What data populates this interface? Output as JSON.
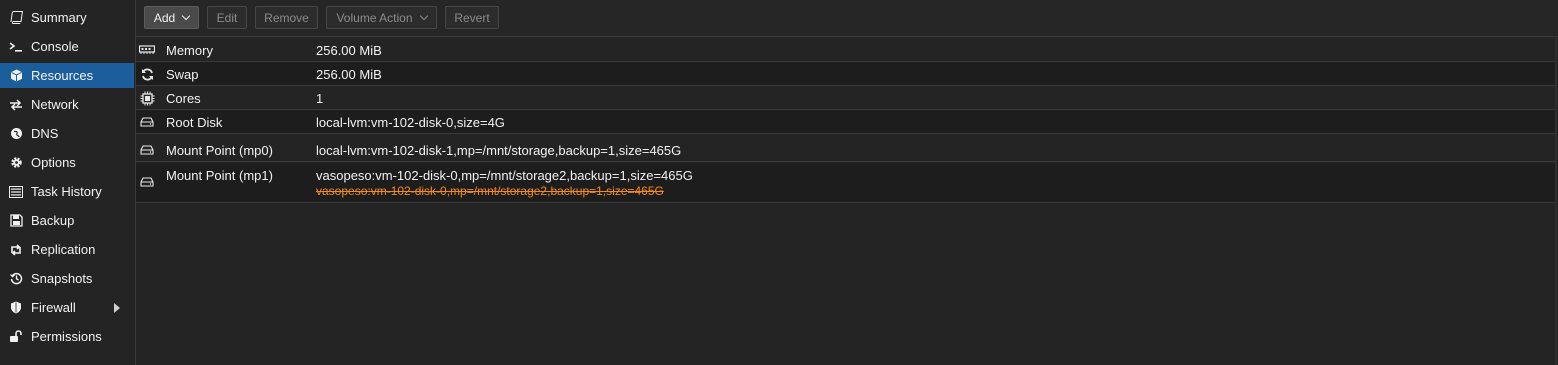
{
  "sidebar": {
    "items": [
      {
        "label": "Summary",
        "icon": "book-icon"
      },
      {
        "label": "Console",
        "icon": "terminal-icon"
      },
      {
        "label": "Resources",
        "icon": "cube-icon",
        "active": true
      },
      {
        "label": "Network",
        "icon": "exchange-icon"
      },
      {
        "label": "DNS",
        "icon": "globe-icon"
      },
      {
        "label": "Options",
        "icon": "gear-icon"
      },
      {
        "label": "Task History",
        "icon": "list-icon"
      },
      {
        "label": "Backup",
        "icon": "floppy-icon"
      },
      {
        "label": "Replication",
        "icon": "retweet-icon"
      },
      {
        "label": "Snapshots",
        "icon": "history-icon"
      },
      {
        "label": "Firewall",
        "icon": "shield-icon",
        "has_submenu": true
      },
      {
        "label": "Permissions",
        "icon": "unlock-icon"
      }
    ]
  },
  "toolbar": {
    "add": "Add",
    "edit": "Edit",
    "remove": "Remove",
    "volume_action": "Volume Action",
    "revert": "Revert"
  },
  "resources": [
    {
      "key": "Memory",
      "value": "256.00 MiB",
      "icon": "memory-icon"
    },
    {
      "key": "Swap",
      "value": "256.00 MiB",
      "icon": "refresh-icon"
    },
    {
      "key": "Cores",
      "value": "1",
      "icon": "cpu-icon"
    },
    {
      "key": "Root Disk",
      "value": "local-lvm:vm-102-disk-0,size=4G",
      "icon": "hdd-icon"
    },
    {
      "key": "Mount Point (mp0)",
      "value": "local-lvm:vm-102-disk-1,mp=/mnt/storage,backup=1,size=465G",
      "icon": "hdd-icon"
    },
    {
      "key": "Mount Point (mp1)",
      "value": "vasopeso:vm-102-disk-0,mp=/mnt/storage2,backup=1,size=465G",
      "pending": "vasopeso:vm-102-disk-0,mp=/mnt/storage2,backup=1,size=465G",
      "icon": "hdd-icon"
    }
  ],
  "colors": {
    "accent": "#1c5e9b",
    "pending": "#f28a1e",
    "background": "#242424"
  }
}
